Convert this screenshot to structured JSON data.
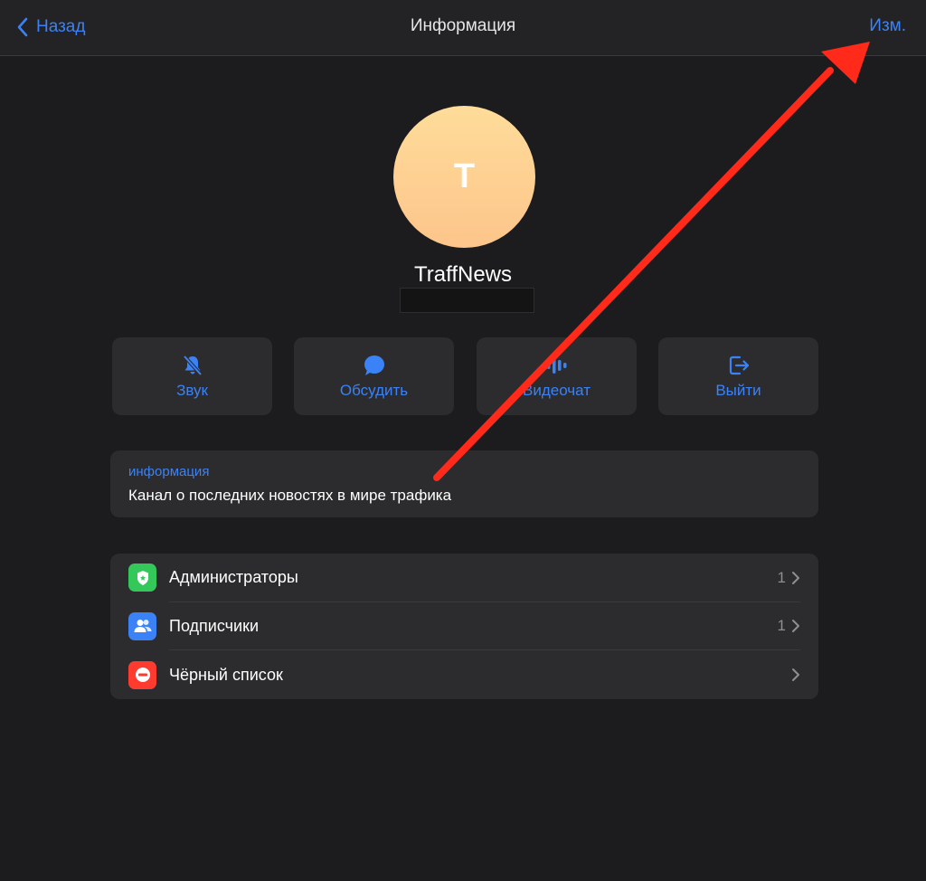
{
  "navbar": {
    "back_label": "Назад",
    "title": "Информация",
    "edit_label": "Изм."
  },
  "profile": {
    "avatar_letter": "T",
    "name": "TraffNews"
  },
  "actions": [
    {
      "label": "Звук",
      "icon": "bell-slash-icon"
    },
    {
      "label": "Обсудить",
      "icon": "chat-bubble-icon"
    },
    {
      "label": "Видеочат",
      "icon": "audio-wave-icon"
    },
    {
      "label": "Выйти",
      "icon": "leave-icon"
    }
  ],
  "info": {
    "label": "информация",
    "text": "Канал о последних новостях в мире трафика"
  },
  "list": [
    {
      "label": "Администраторы",
      "count": "1",
      "icon": "shield-icon",
      "color": "#34c759"
    },
    {
      "label": "Подписчики",
      "count": "1",
      "icon": "people-icon",
      "color": "#3b82f6"
    },
    {
      "label": "Чёрный список",
      "count": "",
      "icon": "minus-circle-icon",
      "color": "#ff3b30"
    }
  ],
  "colors": {
    "accent": "#3b82f6",
    "background": "#1c1c1e",
    "card": "#2c2c2e",
    "annotation_arrow": "#ff2a1a"
  }
}
